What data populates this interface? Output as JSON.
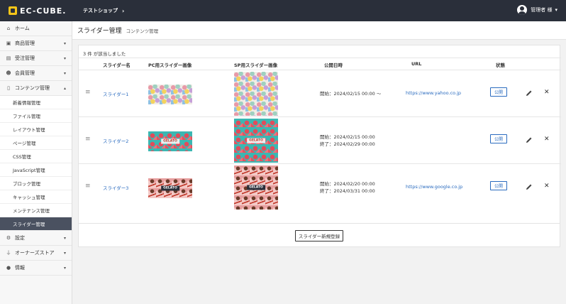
{
  "header": {
    "logo": "EC-CUBE.",
    "shop": "テストショップ",
    "user": "管理者 様"
  },
  "sidebar": {
    "items": [
      {
        "label": "ホーム",
        "icon": "home-icon"
      },
      {
        "label": "商品管理",
        "icon": "cube-icon"
      },
      {
        "label": "受注管理",
        "icon": "cart-icon"
      },
      {
        "label": "会員管理",
        "icon": "users-icon"
      },
      {
        "label": "コンテンツ管理",
        "icon": "file-icon"
      }
    ],
    "content_sub": [
      "新着情報管理",
      "ファイル管理",
      "レイアウト管理",
      "ページ管理",
      "CSS管理",
      "JavaScript管理",
      "ブロック管理",
      "キャッシュ管理",
      "メンテナンス管理",
      "スライダー管理"
    ],
    "bottom": [
      {
        "label": "設定",
        "icon": "gear-icon"
      },
      {
        "label": "オーナーズストア",
        "icon": "plug-icon"
      },
      {
        "label": "情報",
        "icon": "info-icon"
      }
    ]
  },
  "main": {
    "title": "スライダー管理",
    "subtitle": "コンテンツ管理",
    "count": "3 件 が該当しました",
    "columns": [
      "スライダー名",
      "PC用スライダー画像",
      "SP用スライダー画像",
      "公開日時",
      "URL",
      "状態"
    ],
    "rows": [
      {
        "name": "スライダー1",
        "pc_label": "",
        "sp_label": "",
        "date_start": "開始：2024/02/15 00:00 ～",
        "date_end": "",
        "url": "https://www.yahoo.co.jp",
        "status": "公開"
      },
      {
        "name": "スライダー2",
        "pc_label": "GELATO",
        "sp_label": "GELATO",
        "date_start": "開始：2024/02/15 00:00",
        "date_end": "終了：2024/02/29 00:00",
        "url": "",
        "status": "公開"
      },
      {
        "name": "スライダー3",
        "pc_label": "GELATO",
        "sp_label": "GELATO",
        "date_start": "開始：2024/02/20 00:00",
        "date_end": "終了：2024/03/31 00:00",
        "url": "https://www.google.co.jp",
        "status": "公開"
      }
    ],
    "add_button": "スライダー新規登録"
  }
}
